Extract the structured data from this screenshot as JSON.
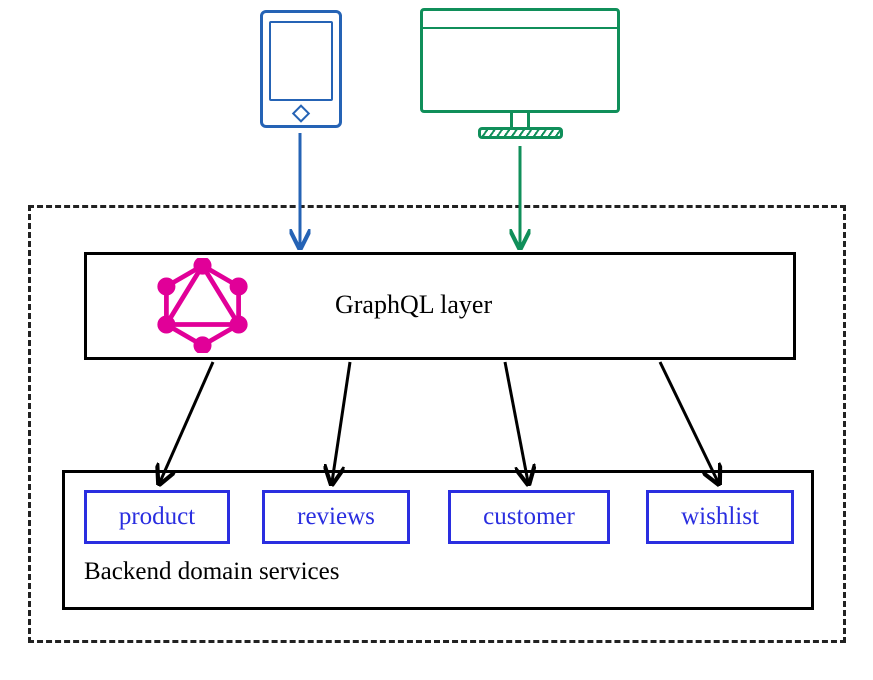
{
  "layer": {
    "label": "GraphQL layer"
  },
  "backend": {
    "label": "Backend domain services",
    "services": [
      "product",
      "reviews",
      "customer",
      "wishlist"
    ]
  },
  "clients": {
    "tablet_color": "#2563b5",
    "monitor_color": "#108f5a"
  },
  "graphql_logo_color": "#e10098"
}
